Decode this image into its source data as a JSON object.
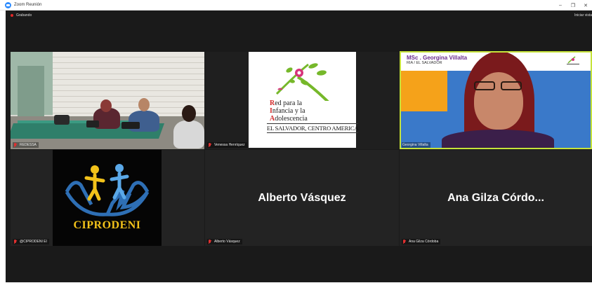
{
  "window": {
    "title": "Zoom Reunión",
    "minimize_glyph": "–",
    "maximize_glyph": "❐",
    "close_glyph": "✕"
  },
  "toolbar": {
    "recording_label": "Grabando",
    "view_label": "Iniciar vista"
  },
  "tiles": [
    {
      "name": "REDESSA",
      "muted": true
    },
    {
      "name": "Venessa Henríquez",
      "muted": true
    },
    {
      "name": "Georgina Villalta",
      "muted": false
    },
    {
      "name": "@CIPRODENI El",
      "muted": true
    },
    {
      "name": "Alberto Vásquez",
      "muted": true
    },
    {
      "name": "Ana Gilza Córdoba",
      "muted": true
    }
  ],
  "ria_logo": {
    "line1_cap": "R",
    "line1_rest": "ed para la",
    "line2_cap": "I",
    "line2_rest": "nfancia y la",
    "line3_cap": "A",
    "line3_rest": "dolescencia",
    "country": "EL SALVADOR, CENTRO AMERICA"
  },
  "georgina_banner": {
    "title": "MSc . Georgina Villalta",
    "subtitle": "RIA / EL SALVADOR"
  },
  "ciprodeni_logo": {
    "text": "CIPRODENI"
  },
  "placeholders": {
    "alberto": "Alberto Vásquez",
    "ana": "Ana Gilza Córdo..."
  },
  "colors": {
    "zoom_blue": "#2D8CFF",
    "active_speaker_border": "#c6e33a",
    "muted_red": "#e03030",
    "meeting_bg": "#1a1a1a"
  }
}
